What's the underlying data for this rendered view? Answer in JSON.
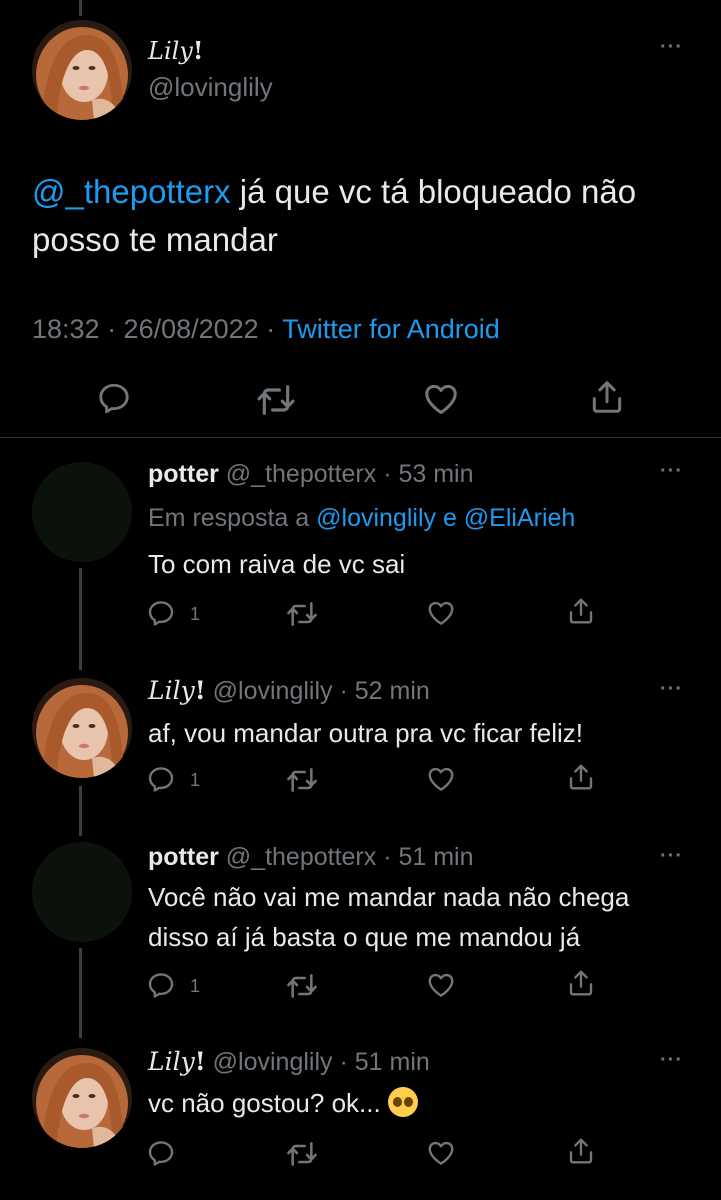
{
  "main": {
    "name": "Lily",
    "name_mark": "!",
    "handle": "@lovinglily",
    "more": "···",
    "mention": "@_thepotterx",
    "text": " já que vc tá bloqueado não posso te mandar",
    "time": "18:32 · 26/08/2022 · ",
    "source": "Twitter for Android"
  },
  "replies": [
    {
      "name": "potter",
      "handle": "@_thepotterx",
      "time": " · 53 min",
      "reply_prefix": "Em resposta a ",
      "reply_to": "@lovinglily e @EliArieh",
      "lines": [
        "To com raiva de vc sai"
      ],
      "reply_count": "1",
      "more": "···"
    },
    {
      "name": "Lily",
      "name_mark": "!",
      "handle": "@lovinglily",
      "time": " · 52 min",
      "lines": [
        "af, vou mandar outra pra vc ficar feliz!"
      ],
      "reply_count": "1",
      "more": "···"
    },
    {
      "name": "potter",
      "handle": "@_thepotterx",
      "time": " · 51 min",
      "lines": [
        "Você não vai me mandar nada não chega",
        "disso aí já basta o que me mandou já"
      ],
      "reply_count": "1",
      "more": "···"
    },
    {
      "name": "Lily",
      "name_mark": "!",
      "handle": "@lovinglily",
      "time": " · 51 min",
      "lines": [
        "vc não gostou? ok... "
      ],
      "more": "···"
    }
  ],
  "icons": {
    "reply": "reply-icon",
    "retweet": "retweet-icon",
    "like": "heart-icon",
    "share": "share-icon",
    "emoji": "pleading-face-emoji"
  },
  "colors": {
    "background": "#000000",
    "text": "#e7e9ea",
    "muted": "#71767b",
    "link": "#1d9bf0",
    "divider": "#2f3336"
  }
}
